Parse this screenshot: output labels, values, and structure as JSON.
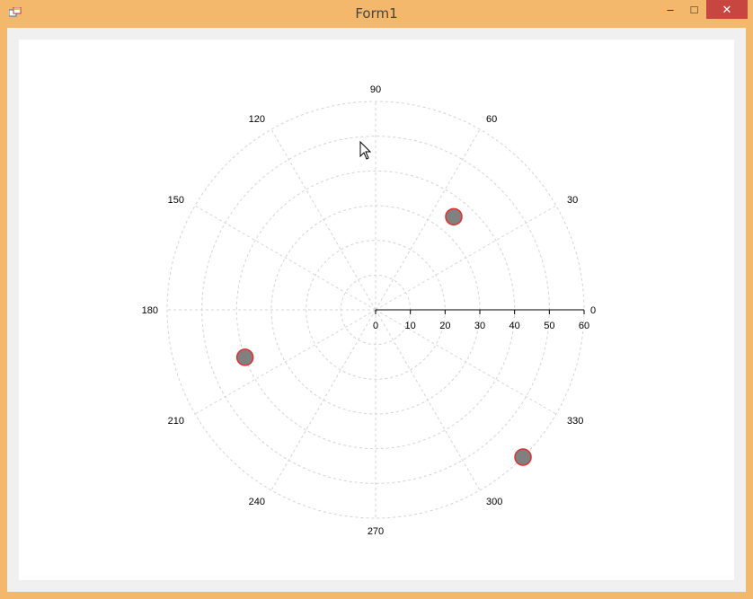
{
  "window": {
    "title": "Form1",
    "minimize_label": "–",
    "maximize_label": "□",
    "close_label": "✕"
  },
  "colors": {
    "frame": "#f3b86b",
    "close": "#c7463f",
    "grid": "#d3d3d3",
    "marker_fill": "#808080",
    "marker_border": "#e03030"
  },
  "chart_data": {
    "type": "scatter",
    "coordinate_system": "polar",
    "angle_labels": [
      "0",
      "30",
      "60",
      "90",
      "120",
      "150",
      "180",
      "210",
      "240",
      "270",
      "300",
      "330"
    ],
    "radial_labels": [
      "0",
      "10",
      "20",
      "30",
      "40",
      "50",
      "60"
    ],
    "rmax": 60,
    "grid": true,
    "series": [
      {
        "points": [
          {
            "angle": 50,
            "r": 35
          },
          {
            "angle": 200,
            "r": 40
          },
          {
            "angle": 315,
            "r": 60
          }
        ]
      }
    ]
  }
}
